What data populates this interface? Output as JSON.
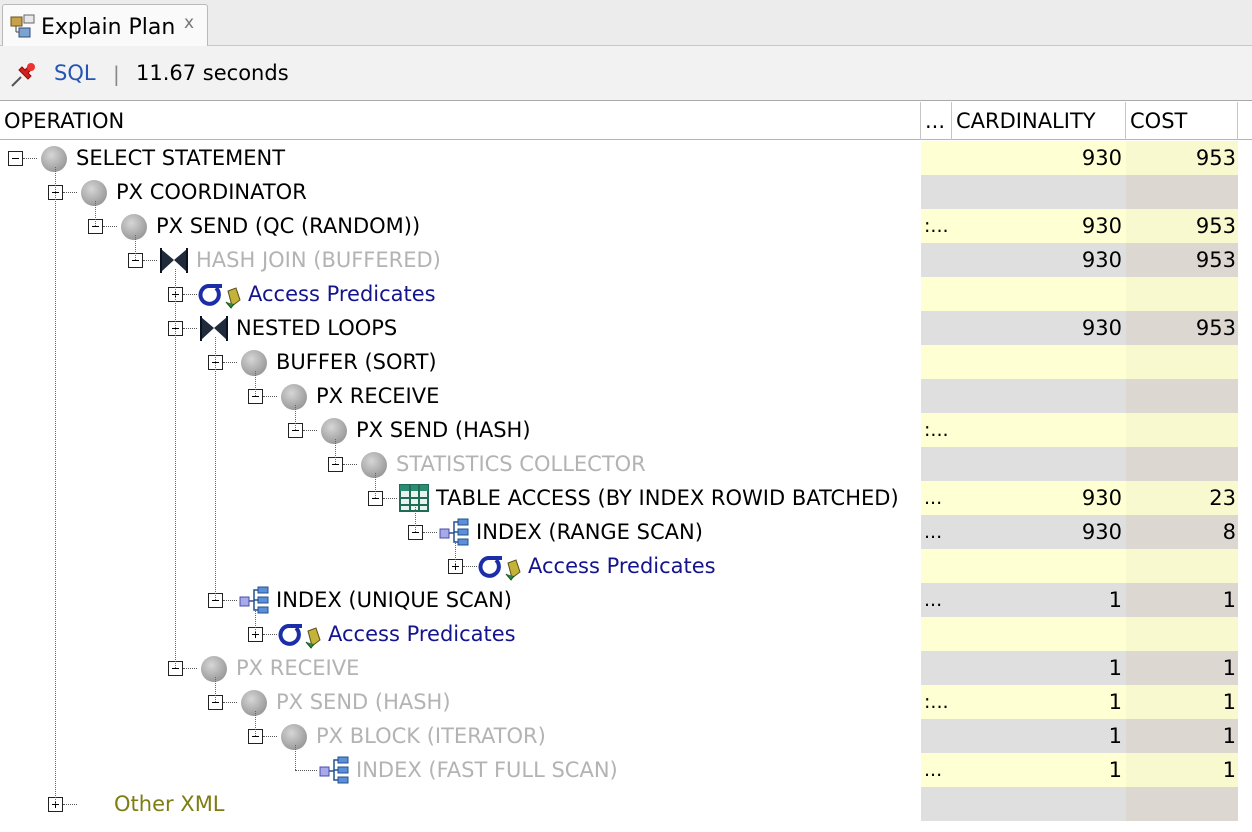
{
  "tab": {
    "title": "Explain Plan",
    "close_glyph": "x",
    "icon": "explain-plan-icon"
  },
  "toolbar": {
    "pin_icon": "pushpin-icon",
    "sql_label": "SQL",
    "separator": "|",
    "elapsed": "11.67 seconds"
  },
  "columns": {
    "operation": "OPERATION",
    "dots": "...",
    "cardinality": "CARDINALITY",
    "cost": "COST"
  },
  "colors": {
    "row_yellow": "#ffffd4",
    "row_gray": "#e0dfdf",
    "link_blue": "#2454b4",
    "predicate_blue": "#14148f",
    "dim_text": "#b3b3b3",
    "other_xml": "#7d7d13"
  },
  "rows": [
    {
      "label": "SELECT STATEMENT",
      "depth": 0,
      "icon": "circle",
      "exp": "minus",
      "style": "normal",
      "dots": "",
      "card": "930",
      "cost": "953"
    },
    {
      "label": "PX COORDINATOR",
      "depth": 1,
      "icon": "circle",
      "exp": "minus",
      "style": "normal",
      "dots": "",
      "card": "",
      "cost": ""
    },
    {
      "label": "PX SEND (QC (RANDOM))",
      "depth": 2,
      "icon": "circle",
      "exp": "minus",
      "style": "normal",
      "dots": ":...",
      "card": "930",
      "cost": "953"
    },
    {
      "label": "HASH JOIN (BUFFERED)",
      "depth": 3,
      "icon": "join",
      "exp": "minus",
      "style": "dim",
      "dots": "",
      "card": "930",
      "cost": "953"
    },
    {
      "label": "Access Predicates",
      "depth": 4,
      "icon": "predicate",
      "exp": "plus",
      "style": "pred",
      "dots": "",
      "card": "",
      "cost": ""
    },
    {
      "label": "NESTED LOOPS",
      "depth": 4,
      "icon": "join",
      "exp": "minus",
      "style": "normal",
      "dots": "",
      "card": "930",
      "cost": "953"
    },
    {
      "label": "BUFFER (SORT)",
      "depth": 5,
      "icon": "circle",
      "exp": "minus",
      "style": "normal",
      "dots": "",
      "card": "",
      "cost": ""
    },
    {
      "label": "PX RECEIVE",
      "depth": 6,
      "icon": "circle",
      "exp": "minus",
      "style": "normal",
      "dots": "",
      "card": "",
      "cost": ""
    },
    {
      "label": "PX SEND (HASH)",
      "depth": 7,
      "icon": "circle",
      "exp": "minus",
      "style": "normal",
      "dots": ":...",
      "card": "",
      "cost": ""
    },
    {
      "label": "STATISTICS COLLECTOR",
      "depth": 8,
      "icon": "circle",
      "exp": "minus",
      "style": "dim",
      "dots": "",
      "card": "",
      "cost": ""
    },
    {
      "label": "TABLE ACCESS (BY INDEX ROWID BATCHED)",
      "depth": 9,
      "icon": "table",
      "exp": "minus",
      "style": "normal",
      "dots": "...",
      "card": "930",
      "cost": "23"
    },
    {
      "label": "INDEX (RANGE SCAN)",
      "depth": 10,
      "icon": "index",
      "exp": "minus",
      "style": "normal",
      "dots": "...",
      "card": "930",
      "cost": "8"
    },
    {
      "label": "Access Predicates",
      "depth": 11,
      "icon": "predicate",
      "exp": "plus",
      "style": "pred",
      "dots": "",
      "card": "",
      "cost": ""
    },
    {
      "label": "INDEX (UNIQUE SCAN)",
      "depth": 5,
      "icon": "index",
      "exp": "minus",
      "style": "normal",
      "dots": "...",
      "card": "1",
      "cost": "1"
    },
    {
      "label": "Access Predicates",
      "depth": 6,
      "icon": "predicate",
      "exp": "plus",
      "style": "pred",
      "dots": "",
      "card": "",
      "cost": ""
    },
    {
      "label": "PX RECEIVE",
      "depth": 4,
      "icon": "circle",
      "exp": "minus",
      "style": "dim",
      "dots": "",
      "card": "1",
      "cost": "1"
    },
    {
      "label": "PX SEND (HASH)",
      "depth": 5,
      "icon": "circle",
      "exp": "minus",
      "style": "dim",
      "dots": ":...",
      "card": "1",
      "cost": "1"
    },
    {
      "label": "PX BLOCK (ITERATOR)",
      "depth": 6,
      "icon": "circle",
      "exp": "minus",
      "style": "dim",
      "dots": "",
      "card": "1",
      "cost": "1"
    },
    {
      "label": "INDEX (FAST FULL SCAN)",
      "depth": 7,
      "icon": "index",
      "exp": "none",
      "style": "dim",
      "dots": "...",
      "card": "1",
      "cost": "1"
    },
    {
      "label": "Other XML",
      "depth": 1,
      "icon": "none",
      "exp": "plus",
      "style": "xml",
      "dots": "",
      "card": "",
      "cost": ""
    }
  ]
}
